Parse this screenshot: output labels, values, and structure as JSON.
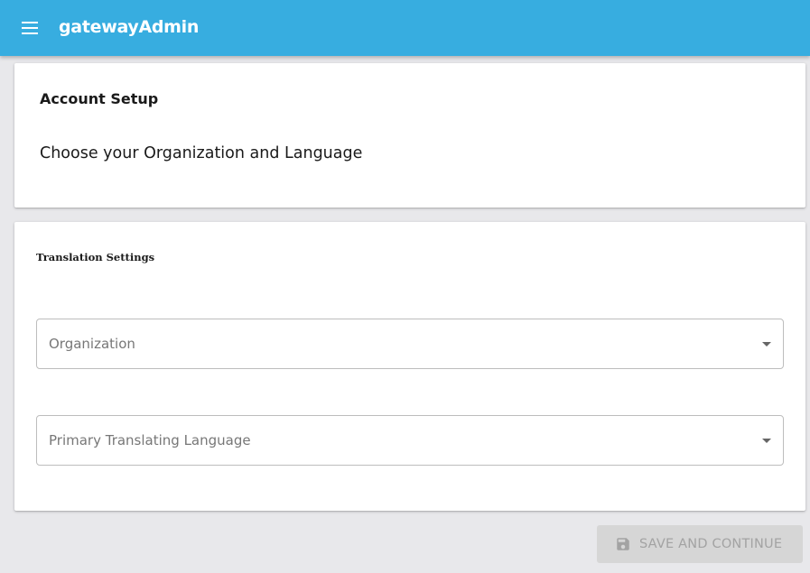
{
  "appbar": {
    "title": "gatewayAdmin",
    "color": "#37ade0",
    "menu_icon": "menu-icon"
  },
  "account_setup": {
    "title": "Account Setup",
    "subtitle": "Choose your Organization and Language"
  },
  "translation_settings": {
    "title": "Translation Settings",
    "organization_label": "Organization",
    "language_label": "Primary Translating Language"
  },
  "footer": {
    "save_label": "SAVE AND CONTINUE",
    "save_icon": "save-icon",
    "save_disabled": true
  }
}
